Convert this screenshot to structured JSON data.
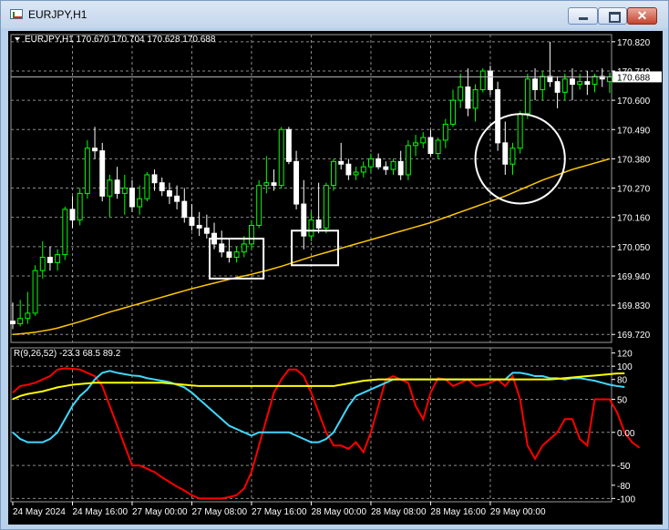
{
  "window": {
    "title": "EURJPY,H1",
    "buttons": {
      "minimize": "minimize",
      "maximize": "maximize",
      "close": "✕"
    }
  },
  "colors": {
    "background": "#000000",
    "bull_candle": "#00ff00",
    "bear_candle": "#ffffff",
    "moving_average": "#ffc800",
    "grid": "#8c8c8c",
    "text": "#ffffff",
    "indicator_red": "#ff0000",
    "indicator_cyan": "#3fd8ff",
    "indicator_yellow": "#ffff00",
    "annotation": "#ffffff"
  },
  "chart_data": [
    {
      "type": "candlestick",
      "header": "EURJPY,H1 170.670 170.704 170.628 170.688",
      "ylim": [
        169.69,
        170.84
      ],
      "y_ticks": [
        "170.820",
        "170.710",
        "170.600",
        "170.490",
        "170.380",
        "170.270",
        "170.160",
        "170.050",
        "169.940",
        "169.830",
        "169.720"
      ],
      "current_price": "170.688",
      "x_ticks": [
        "24 May 2024",
        "24 May 16:00",
        "27 May 00:00",
        "27 May 08:00",
        "27 May 16:00",
        "28 May 00:00",
        "28 May 08:00",
        "28 May 16:00",
        "29 May 00:00"
      ],
      "grid": true,
      "candles": [
        {
          "o": 169.77,
          "h": 169.84,
          "l": 169.74,
          "c": 169.76
        },
        {
          "o": 169.76,
          "h": 169.85,
          "l": 169.75,
          "c": 169.78
        },
        {
          "o": 169.78,
          "h": 169.88,
          "l": 169.76,
          "c": 169.8
        },
        {
          "o": 169.8,
          "h": 169.98,
          "l": 169.79,
          "c": 169.96
        },
        {
          "o": 169.96,
          "h": 170.07,
          "l": 169.93,
          "c": 170.01
        },
        {
          "o": 170.01,
          "h": 170.05,
          "l": 169.96,
          "c": 169.99
        },
        {
          "o": 169.99,
          "h": 170.04,
          "l": 169.96,
          "c": 170.02
        },
        {
          "o": 170.02,
          "h": 170.2,
          "l": 170.0,
          "c": 170.19
        },
        {
          "o": 170.19,
          "h": 170.24,
          "l": 170.12,
          "c": 170.15
        },
        {
          "o": 170.15,
          "h": 170.27,
          "l": 170.13,
          "c": 170.25
        },
        {
          "o": 170.25,
          "h": 170.45,
          "l": 170.23,
          "c": 170.42
        },
        {
          "o": 170.42,
          "h": 170.5,
          "l": 170.38,
          "c": 170.41
        },
        {
          "o": 170.41,
          "h": 170.44,
          "l": 170.22,
          "c": 170.24
        },
        {
          "o": 170.24,
          "h": 170.32,
          "l": 170.16,
          "c": 170.3
        },
        {
          "o": 170.3,
          "h": 170.35,
          "l": 170.23,
          "c": 170.25
        },
        {
          "o": 170.25,
          "h": 170.32,
          "l": 170.17,
          "c": 170.27
        },
        {
          "o": 170.27,
          "h": 170.3,
          "l": 170.18,
          "c": 170.2
        },
        {
          "o": 170.2,
          "h": 170.28,
          "l": 170.17,
          "c": 170.23
        },
        {
          "o": 170.23,
          "h": 170.33,
          "l": 170.22,
          "c": 170.32
        },
        {
          "o": 170.32,
          "h": 170.34,
          "l": 170.26,
          "c": 170.29
        },
        {
          "o": 170.29,
          "h": 170.31,
          "l": 170.24,
          "c": 170.26
        },
        {
          "o": 170.26,
          "h": 170.29,
          "l": 170.21,
          "c": 170.24
        },
        {
          "o": 170.24,
          "h": 170.28,
          "l": 170.19,
          "c": 170.22
        },
        {
          "o": 170.22,
          "h": 170.27,
          "l": 170.14,
          "c": 170.16
        },
        {
          "o": 170.16,
          "h": 170.21,
          "l": 170.11,
          "c": 170.13
        },
        {
          "o": 170.13,
          "h": 170.18,
          "l": 170.09,
          "c": 170.12
        },
        {
          "o": 170.12,
          "h": 170.17,
          "l": 170.08,
          "c": 170.1
        },
        {
          "o": 170.1,
          "h": 170.14,
          "l": 170.04,
          "c": 170.06
        },
        {
          "o": 170.06,
          "h": 170.11,
          "l": 170.01,
          "c": 170.03
        },
        {
          "o": 170.03,
          "h": 170.08,
          "l": 169.99,
          "c": 170.01
        },
        {
          "o": 170.01,
          "h": 170.05,
          "l": 169.99,
          "c": 170.03
        },
        {
          "o": 170.03,
          "h": 170.09,
          "l": 170.01,
          "c": 170.06
        },
        {
          "o": 170.06,
          "h": 170.15,
          "l": 170.04,
          "c": 170.13
        },
        {
          "o": 170.13,
          "h": 170.3,
          "l": 170.12,
          "c": 170.28
        },
        {
          "o": 170.28,
          "h": 170.39,
          "l": 170.25,
          "c": 170.29
        },
        {
          "o": 170.29,
          "h": 170.34,
          "l": 170.26,
          "c": 170.28
        },
        {
          "o": 170.28,
          "h": 170.5,
          "l": 170.27,
          "c": 170.49
        },
        {
          "o": 170.49,
          "h": 170.5,
          "l": 170.36,
          "c": 170.37
        },
        {
          "o": 170.37,
          "h": 170.41,
          "l": 170.19,
          "c": 170.21
        },
        {
          "o": 170.21,
          "h": 170.3,
          "l": 170.04,
          "c": 170.09
        },
        {
          "o": 170.09,
          "h": 170.18,
          "l": 170.07,
          "c": 170.15
        },
        {
          "o": 170.15,
          "h": 170.29,
          "l": 170.1,
          "c": 170.12
        },
        {
          "o": 170.12,
          "h": 170.29,
          "l": 170.1,
          "c": 170.28
        },
        {
          "o": 170.28,
          "h": 170.38,
          "l": 170.26,
          "c": 170.37
        },
        {
          "o": 170.37,
          "h": 170.44,
          "l": 170.34,
          "c": 170.36
        },
        {
          "o": 170.36,
          "h": 170.38,
          "l": 170.3,
          "c": 170.32
        },
        {
          "o": 170.32,
          "h": 170.35,
          "l": 170.3,
          "c": 170.33
        },
        {
          "o": 170.33,
          "h": 170.37,
          "l": 170.31,
          "c": 170.35
        },
        {
          "o": 170.35,
          "h": 170.4,
          "l": 170.33,
          "c": 170.38
        },
        {
          "o": 170.38,
          "h": 170.4,
          "l": 170.34,
          "c": 170.35
        },
        {
          "o": 170.35,
          "h": 170.37,
          "l": 170.32,
          "c": 170.34
        },
        {
          "o": 170.34,
          "h": 170.38,
          "l": 170.32,
          "c": 170.37
        },
        {
          "o": 170.37,
          "h": 170.41,
          "l": 170.3,
          "c": 170.32
        },
        {
          "o": 170.32,
          "h": 170.45,
          "l": 170.3,
          "c": 170.43
        },
        {
          "o": 170.43,
          "h": 170.47,
          "l": 170.39,
          "c": 170.44
        },
        {
          "o": 170.44,
          "h": 170.48,
          "l": 170.42,
          "c": 170.46
        },
        {
          "o": 170.46,
          "h": 170.49,
          "l": 170.39,
          "c": 170.4
        },
        {
          "o": 170.4,
          "h": 170.46,
          "l": 170.38,
          "c": 170.45
        },
        {
          "o": 170.45,
          "h": 170.53,
          "l": 170.42,
          "c": 170.51
        },
        {
          "o": 170.51,
          "h": 170.64,
          "l": 170.5,
          "c": 170.6
        },
        {
          "o": 170.6,
          "h": 170.7,
          "l": 170.57,
          "c": 170.65
        },
        {
          "o": 170.65,
          "h": 170.72,
          "l": 170.54,
          "c": 170.57
        },
        {
          "o": 170.57,
          "h": 170.66,
          "l": 170.52,
          "c": 170.64
        },
        {
          "o": 170.64,
          "h": 170.72,
          "l": 170.63,
          "c": 170.71
        },
        {
          "o": 170.71,
          "h": 170.73,
          "l": 170.62,
          "c": 170.64
        },
        {
          "o": 170.64,
          "h": 170.67,
          "l": 170.41,
          "c": 170.44
        },
        {
          "o": 170.44,
          "h": 170.52,
          "l": 170.32,
          "c": 170.36
        },
        {
          "o": 170.36,
          "h": 170.44,
          "l": 170.32,
          "c": 170.42
        },
        {
          "o": 170.42,
          "h": 170.56,
          "l": 170.4,
          "c": 170.55
        },
        {
          "o": 170.55,
          "h": 170.7,
          "l": 170.53,
          "c": 170.68
        },
        {
          "o": 170.68,
          "h": 170.72,
          "l": 170.6,
          "c": 170.64
        },
        {
          "o": 170.64,
          "h": 170.71,
          "l": 170.6,
          "c": 170.69
        },
        {
          "o": 170.69,
          "h": 170.82,
          "l": 170.65,
          "c": 170.67
        },
        {
          "o": 170.67,
          "h": 170.69,
          "l": 170.57,
          "c": 170.63
        },
        {
          "o": 170.63,
          "h": 170.7,
          "l": 170.6,
          "c": 170.68
        },
        {
          "o": 170.68,
          "h": 170.72,
          "l": 170.6,
          "c": 170.66
        },
        {
          "o": 170.66,
          "h": 170.7,
          "l": 170.64,
          "c": 170.67
        },
        {
          "o": 170.67,
          "h": 170.71,
          "l": 170.62,
          "c": 170.66
        },
        {
          "o": 170.66,
          "h": 170.7,
          "l": 170.63,
          "c": 170.69
        },
        {
          "o": 170.69,
          "h": 170.72,
          "l": 170.65,
          "c": 170.68
        },
        {
          "o": 170.67,
          "h": 170.704,
          "l": 170.628,
          "c": 170.688
        }
      ],
      "moving_average": [
        169.72,
        169.722,
        169.725,
        169.728,
        169.733,
        169.738,
        169.744,
        169.752,
        169.76,
        169.768,
        169.777,
        169.786,
        169.795,
        169.804,
        169.812,
        169.82,
        169.828,
        169.836,
        169.844,
        169.852,
        169.86,
        169.868,
        169.876,
        169.884,
        169.892,
        169.899,
        169.906,
        169.913,
        169.92,
        169.927,
        169.934,
        169.94,
        169.946,
        169.953,
        169.96,
        169.968,
        169.976,
        169.985,
        169.994,
        170.003,
        170.012,
        170.02,
        170.028,
        170.036,
        170.044,
        170.052,
        170.06,
        170.068,
        170.076,
        170.084,
        170.092,
        170.1,
        170.108,
        170.116,
        170.124,
        170.132,
        170.14,
        170.15,
        170.16,
        170.17,
        170.18,
        170.19,
        170.2,
        170.21,
        170.22,
        170.23,
        170.24,
        170.252,
        170.264,
        170.276,
        170.288,
        170.3,
        170.31,
        170.32,
        170.33,
        170.34,
        170.348,
        170.356,
        170.364,
        170.372,
        170.38
      ],
      "annotations": [
        {
          "shape": "rectangle",
          "from_bar": 27,
          "to_bar": 33,
          "price_top": 170.08,
          "price_bottom": 169.93
        },
        {
          "shape": "rectangle",
          "from_bar": 38,
          "to_bar": 43,
          "price_top": 170.11,
          "price_bottom": 169.98
        },
        {
          "shape": "circle",
          "center_bar": 68,
          "center_price": 170.38,
          "radius_bars": 6
        }
      ]
    },
    {
      "type": "line",
      "header": "R(9,26,52) -23.3 68.5 89.2",
      "ylim": [
        -105,
        125
      ],
      "y_ticks": [
        "120",
        "100",
        "80",
        "50",
        "0.00",
        "-50",
        "-80",
        "-100"
      ],
      "series": [
        {
          "values": [
            60,
            70,
            72,
            75,
            80,
            85,
            95,
            97,
            96,
            95,
            90,
            85,
            70,
            40,
            10,
            -20,
            -50,
            -50,
            -55,
            -60,
            -68,
            -75,
            -82,
            -88,
            -95,
            -100,
            -100,
            -100,
            -100,
            -98,
            -95,
            -85,
            -60,
            -20,
            20,
            60,
            80,
            95,
            95,
            85,
            60,
            30,
            0,
            -20,
            -20,
            -25,
            -15,
            -30,
            0,
            40,
            80,
            85,
            80,
            75,
            40,
            20,
            60,
            82,
            80,
            70,
            75,
            80,
            70,
            72,
            75,
            80,
            70,
            85,
            50,
            -20,
            -40,
            -20,
            -10,
            0,
            20,
            20,
            -10,
            -20,
            50,
            50,
            50,
            30,
            0,
            -15,
            -23.3
          ]
        },
        {
          "values": [
            0,
            -10,
            -15,
            -15,
            -15,
            -10,
            0,
            20,
            40,
            55,
            65,
            80,
            90,
            93,
            90,
            88,
            86,
            85,
            82,
            80,
            78,
            76,
            72,
            68,
            60,
            50,
            40,
            30,
            20,
            10,
            5,
            0,
            -5,
            0,
            0,
            0,
            0,
            0,
            -5,
            -10,
            -15,
            -15,
            -10,
            0,
            20,
            40,
            55,
            60,
            65,
            70,
            75,
            80,
            80,
            80,
            80,
            80,
            80,
            80,
            80,
            80,
            80,
            80,
            80,
            80,
            80,
            80,
            80,
            90,
            90,
            88,
            85,
            85,
            82,
            82,
            80,
            82,
            82,
            80,
            78,
            75,
            72,
            70,
            68.5
          ]
        },
        {
          "values": [
            50,
            55,
            58,
            60,
            62,
            65,
            68,
            70,
            72,
            73,
            74,
            75,
            75,
            75,
            75,
            75,
            75,
            75,
            75,
            75,
            75,
            74,
            73,
            72,
            71,
            70,
            70,
            70,
            70,
            70,
            70,
            70,
            70,
            70,
            70,
            70,
            70,
            70,
            70,
            70,
            70,
            70,
            70,
            70,
            72,
            74,
            76,
            78,
            79,
            80,
            80,
            80,
            80,
            80,
            80,
            80,
            80,
            80,
            80,
            80,
            80,
            80,
            80,
            80,
            80,
            80,
            80,
            80,
            80,
            80,
            80,
            80,
            80,
            81,
            82,
            83,
            84,
            85,
            86,
            87,
            88,
            89,
            89.2
          ]
        }
      ]
    }
  ]
}
